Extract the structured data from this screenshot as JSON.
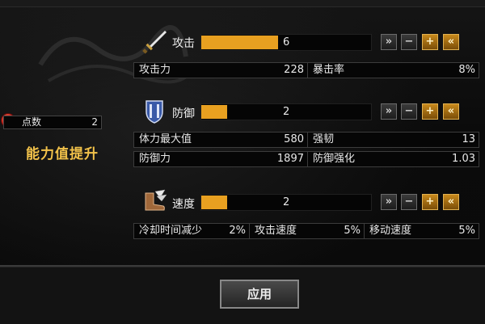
{
  "points": {
    "label": "点数",
    "value": "2",
    "title": "能力值提升",
    "warning_icon": "exclamation-icon",
    "warning_color": "#c0201a"
  },
  "stats": [
    {
      "name": "攻击",
      "icon": "sword-icon",
      "value": "6",
      "bar_fraction": 0.45,
      "bar_color": "#e8a020",
      "details": [
        [
          {
            "label": "攻击力",
            "value": "228"
          },
          {
            "label": "暴击率",
            "value": "8%"
          }
        ]
      ]
    },
    {
      "name": "防御",
      "icon": "shield-icon",
      "value": "2",
      "bar_fraction": 0.15,
      "bar_color": "#e8a020",
      "details": [
        [
          {
            "label": "体力最大值",
            "value": "580"
          },
          {
            "label": "强韧",
            "value": "13"
          }
        ],
        [
          {
            "label": "防御力",
            "value": "1897"
          },
          {
            "label": "防御强化",
            "value": "1.03"
          }
        ]
      ]
    },
    {
      "name": "速度",
      "icon": "boot-icon",
      "value": "2",
      "bar_fraction": 0.15,
      "bar_color": "#e8a020",
      "details": [
        [
          {
            "label": "冷却时间减少",
            "value": "2%"
          },
          {
            "label": "攻击速度",
            "value": "5%"
          },
          {
            "label": "移动速度",
            "value": "5%"
          }
        ]
      ]
    }
  ],
  "buttons": {
    "max_down": "»",
    "minus": "−",
    "plus": "+",
    "max_up": "«"
  },
  "apply_label": "应用",
  "accent_gold": "#e8a020"
}
